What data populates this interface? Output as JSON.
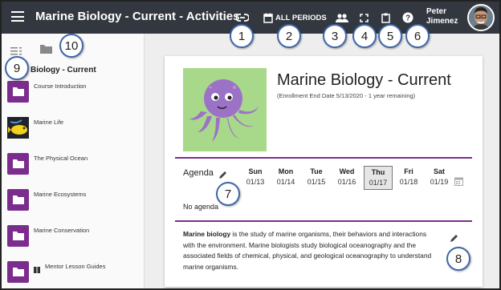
{
  "header": {
    "title": "Marine Biology - Current - Activities",
    "periods_label": "ALL PERIODS",
    "user_first": "Peter",
    "user_last": "Jimenez"
  },
  "callouts": [
    "1",
    "2",
    "3",
    "4",
    "5",
    "6",
    "7",
    "8",
    "9",
    "10"
  ],
  "sidebar": {
    "section_title": "Biology - Current",
    "items": [
      {
        "label": "Course Introduction",
        "icon": "folder-icon"
      },
      {
        "label": "Marine Life",
        "icon": "fish-photo"
      },
      {
        "label": "The Physical Ocean",
        "icon": "folder-icon"
      },
      {
        "label": "Marine Ecosystems",
        "icon": "folder-icon"
      },
      {
        "label": "Marine Conservation",
        "icon": "folder-icon"
      },
      {
        "label": "Mentor Lesson Guides",
        "icon": "folder-icon"
      }
    ]
  },
  "course": {
    "title": "Marine Biology - Current",
    "enrollment": "(Enrollment End Date 5/13/2020 - 1 year remaining)",
    "agenda_label": "Agenda",
    "no_agenda": "No agenda",
    "days": [
      {
        "name": "Sun",
        "date": "01/13"
      },
      {
        "name": "Mon",
        "date": "01/14"
      },
      {
        "name": "Tue",
        "date": "01/15"
      },
      {
        "name": "Wed",
        "date": "01/16"
      },
      {
        "name": "Thu",
        "date": "01/17"
      },
      {
        "name": "Fri",
        "date": "01/18"
      },
      {
        "name": "Sat",
        "date": "01/19"
      }
    ],
    "selected_day": "Thu",
    "description_bold": "Marine biology",
    "description_rest": " is the study of marine organisms, their behaviors and interactions with the environment. Marine biologists study biological oceanography and the associated fields of chemical, physical, and geological oceanography to understand marine organisms."
  },
  "colors": {
    "topbar": "#333840",
    "accent_purple": "#7b2d8e",
    "callout_border": "#3f67a8",
    "octopus": "#9b72c6",
    "image_bg": "#a8d88a"
  }
}
